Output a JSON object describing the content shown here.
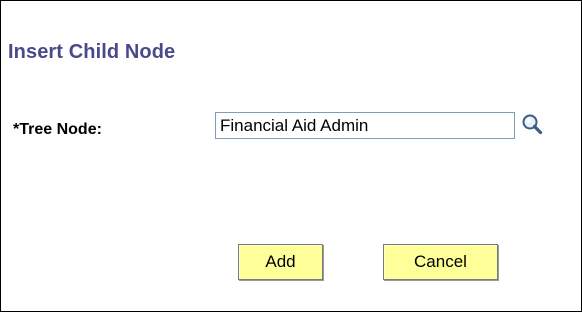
{
  "dialog": {
    "title": "Insert Child Node"
  },
  "form": {
    "tree_node_label": "*Tree Node:",
    "tree_node_value": "Financial Aid Admin",
    "lookup_icon": "magnifier-icon"
  },
  "buttons": {
    "add_label": "Add",
    "cancel_label": "Cancel"
  },
  "colors": {
    "title": "#4a4a8a",
    "button_background": "#ffff99",
    "input_border": "#7f9db9"
  }
}
